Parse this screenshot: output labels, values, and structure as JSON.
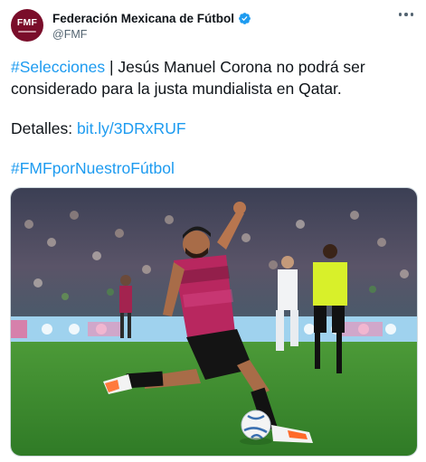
{
  "author": {
    "display_name": "Federación Mexicana de Fútbol",
    "handle": "@FMF",
    "avatar_text": "FMF",
    "verified": true
  },
  "tweet": {
    "hashtag_1": "#Selecciones",
    "text_1": " | Jesús Manuel Corona no podrá ser considerado para la justa mundialista en Qatar.",
    "details_label": "Detalles: ",
    "details_link": "bit.ly/3DRxRUF",
    "hashtag_2": "#FMFporNuestroFútbol"
  },
  "colors": {
    "link": "#1d9bf0",
    "verified": "#1d9bf0",
    "avatar_bg": "#7a0d2a",
    "pitch": "#3e8a2e",
    "jersey": "#b8275f"
  },
  "icons": {
    "verified": "verified-badge-icon",
    "more": "more-options-icon"
  }
}
